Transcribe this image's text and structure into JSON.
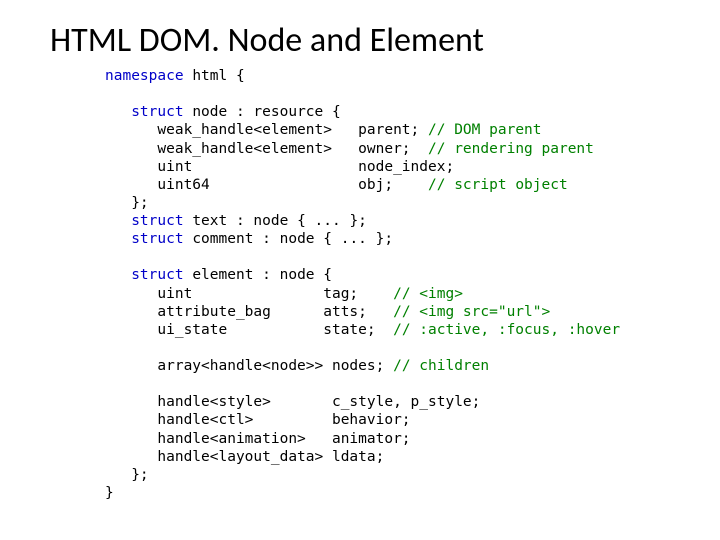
{
  "title": "HTML DOM. Node and Element",
  "code": {
    "l01a": "namespace ",
    "l01b": "html {",
    "blank1": "",
    "l02a": "   struct ",
    "l02b": "node : resource {",
    "l03a": "      weak_handle<element>   parent; ",
    "l03b": "// DOM parent",
    "l04a": "      weak_handle<element>   owner;  ",
    "l04b": "// rendering parent",
    "l05": "      uint                   node_index;",
    "l06a": "      uint64                 obj;    ",
    "l06b": "// script object",
    "l07": "   };",
    "l08a": "   struct ",
    "l08b": "text : node { ... };",
    "l09a": "   struct ",
    "l09b": "comment : node { ... };",
    "blank2": "",
    "l10a": "   struct ",
    "l10b": "element : node {",
    "l11a": "      uint               tag;    ",
    "l11b": "// <img>",
    "l12a": "      attribute_bag      atts;   ",
    "l12b": "// <img src=\"url\">",
    "l13a": "      ui_state           state;  ",
    "l13b": "// :active, :focus, :hover",
    "blank3": "",
    "l14a": "      array<handle<node>> nodes; ",
    "l14b": "// children",
    "blank4": "",
    "l15": "      handle<style>       c_style, p_style;",
    "l16": "      handle<ctl>         behavior;",
    "l17": "      handle<animation>   animator;",
    "l18": "      handle<layout_data> ldata;",
    "l19": "   };",
    "l20": "}"
  }
}
